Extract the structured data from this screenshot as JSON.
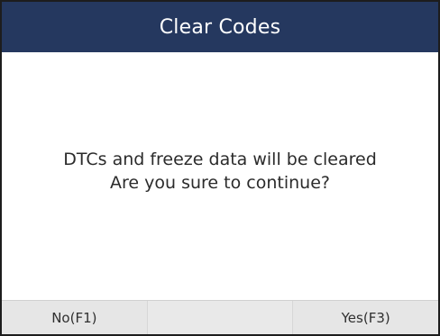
{
  "screen": {
    "title": "Clear Codes",
    "message_lines": [
      "DTCs and freeze data will be cleared",
      "Are you sure to continue?"
    ]
  },
  "footer": {
    "buttons": [
      {
        "label": "No(F1)"
      },
      {
        "label": ""
      },
      {
        "label": "Yes(F3)"
      }
    ]
  },
  "colors": {
    "title_bar": "#25385f",
    "title_text": "#ffffff",
    "body_text": "#2b2b2b",
    "footer_bg": "#e6e6e6"
  }
}
